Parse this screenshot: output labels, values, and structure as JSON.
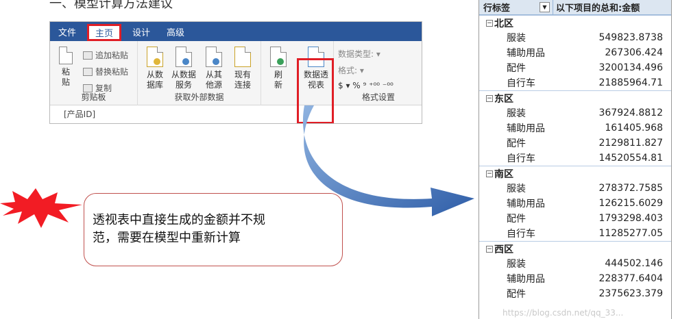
{
  "caption": "一、模型计算方法建议",
  "ribbon": {
    "tabs": [
      {
        "label": "文件"
      },
      {
        "label": "主页",
        "active": true
      },
      {
        "label": "设计"
      },
      {
        "label": "高级"
      }
    ],
    "clipboard": {
      "paste_label": "粘贴",
      "append_paste": "追加粘贴",
      "replace_paste": "替换粘贴",
      "copy": "复制",
      "group_label": "剪贴板"
    },
    "external": {
      "from_db": "从数据库",
      "from_service": "从数据服务",
      "from_other": "从其他源",
      "existing": "现有连接",
      "group_label": "获取外部数据"
    },
    "refresh": "刷新",
    "pivot": "数据透视表",
    "format": {
      "data_type": "数据类型:",
      "format": "格式:",
      "currency": "$ ▾ % ",
      "group_label": "格式设置"
    },
    "formula_bar": "[产品ID]"
  },
  "callout": {
    "line1": "透视表中直接生成的金额并不规",
    "line2": "范，需要在模型中重新计算"
  },
  "pivot_table": {
    "header_left": "行标签",
    "header_right": "以下项目的总和:金额",
    "regions": [
      {
        "name": "北区",
        "items": [
          {
            "label": "服装",
            "value": "549823.8738"
          },
          {
            "label": "辅助用品",
            "value": "267306.424"
          },
          {
            "label": "配件",
            "value": "3200134.496"
          },
          {
            "label": "自行车",
            "value": "21885964.71"
          }
        ]
      },
      {
        "name": "东区",
        "items": [
          {
            "label": "服装",
            "value": "367924.8812"
          },
          {
            "label": "辅助用品",
            "value": "161405.968"
          },
          {
            "label": "配件",
            "value": "2129811.827"
          },
          {
            "label": "自行车",
            "value": "14520554.81"
          }
        ]
      },
      {
        "name": "南区",
        "items": [
          {
            "label": "服装",
            "value": "278372.7585"
          },
          {
            "label": "辅助用品",
            "value": "126215.6029"
          },
          {
            "label": "配件",
            "value": "1793298.403"
          },
          {
            "label": "自行车",
            "value": "11285277.05"
          }
        ]
      },
      {
        "name": "西区",
        "items": [
          {
            "label": "服装",
            "value": "444502.146"
          },
          {
            "label": "辅助用品",
            "value": "228377.6404"
          },
          {
            "label": "配件",
            "value": "2375623.379"
          }
        ]
      }
    ],
    "watermark": "https://blog.csdn.net/qq_33..."
  },
  "colors": {
    "ribbon_blue": "#2b579a",
    "highlight_red": "#e01e26",
    "arrow_blue": "#3a6fb5"
  }
}
